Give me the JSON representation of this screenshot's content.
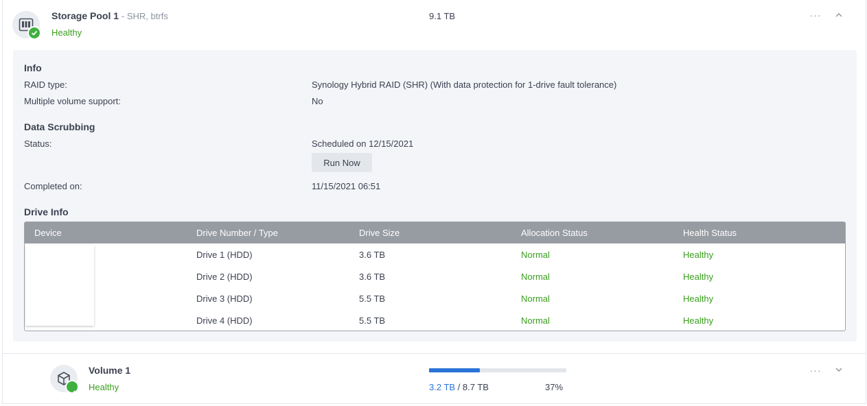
{
  "pool": {
    "title": "Storage Pool 1",
    "subtitle": "- SHR, btrfs",
    "status": "Healthy",
    "size": "9.1 TB",
    "more": "···"
  },
  "info": {
    "heading": "Info",
    "raid_label": "RAID type:",
    "raid_value": "Synology Hybrid RAID (SHR) (With data protection for 1-drive fault tolerance)",
    "multi_label": "Multiple volume support:",
    "multi_value": "No"
  },
  "scrubbing": {
    "heading": "Data Scrubbing",
    "status_label": "Status:",
    "status_value": "Scheduled on 12/15/2021",
    "run_now": "Run Now",
    "completed_label": "Completed on:",
    "completed_value": "11/15/2021 06:51"
  },
  "drive_info": {
    "heading": "Drive Info",
    "columns": [
      "Device",
      "Drive Number / Type",
      "Drive Size",
      "Allocation Status",
      "Health Status"
    ],
    "rows": [
      {
        "drive": "Drive 1 (HDD)",
        "size": "3.6 TB",
        "allocation": "Normal",
        "health": "Healthy"
      },
      {
        "drive": "Drive 2 (HDD)",
        "size": "3.6 TB",
        "allocation": "Normal",
        "health": "Healthy"
      },
      {
        "drive": "Drive 3 (HDD)",
        "size": "5.5 TB",
        "allocation": "Normal",
        "health": "Healthy"
      },
      {
        "drive": "Drive 4 (HDD)",
        "size": "5.5 TB",
        "allocation": "Normal",
        "health": "Healthy"
      }
    ]
  },
  "volume": {
    "title": "Volume 1",
    "status": "Healthy",
    "used": "3.2 TB",
    "separator": " / ",
    "total": "8.7 TB",
    "percent_label": "37%",
    "percent": 0.37,
    "more": "···"
  },
  "colors": {
    "healthy": "#3a9e1e",
    "accent": "#2b74d8",
    "table_header": "#979ba2"
  },
  "icons": {
    "pool": "storage-pool-icon",
    "volume": "volume-cube-icon",
    "check": "check-badge-icon",
    "collapse": "chevron-up-icon",
    "expand": "chevron-down-icon",
    "more": "more-horizontal-icon"
  }
}
